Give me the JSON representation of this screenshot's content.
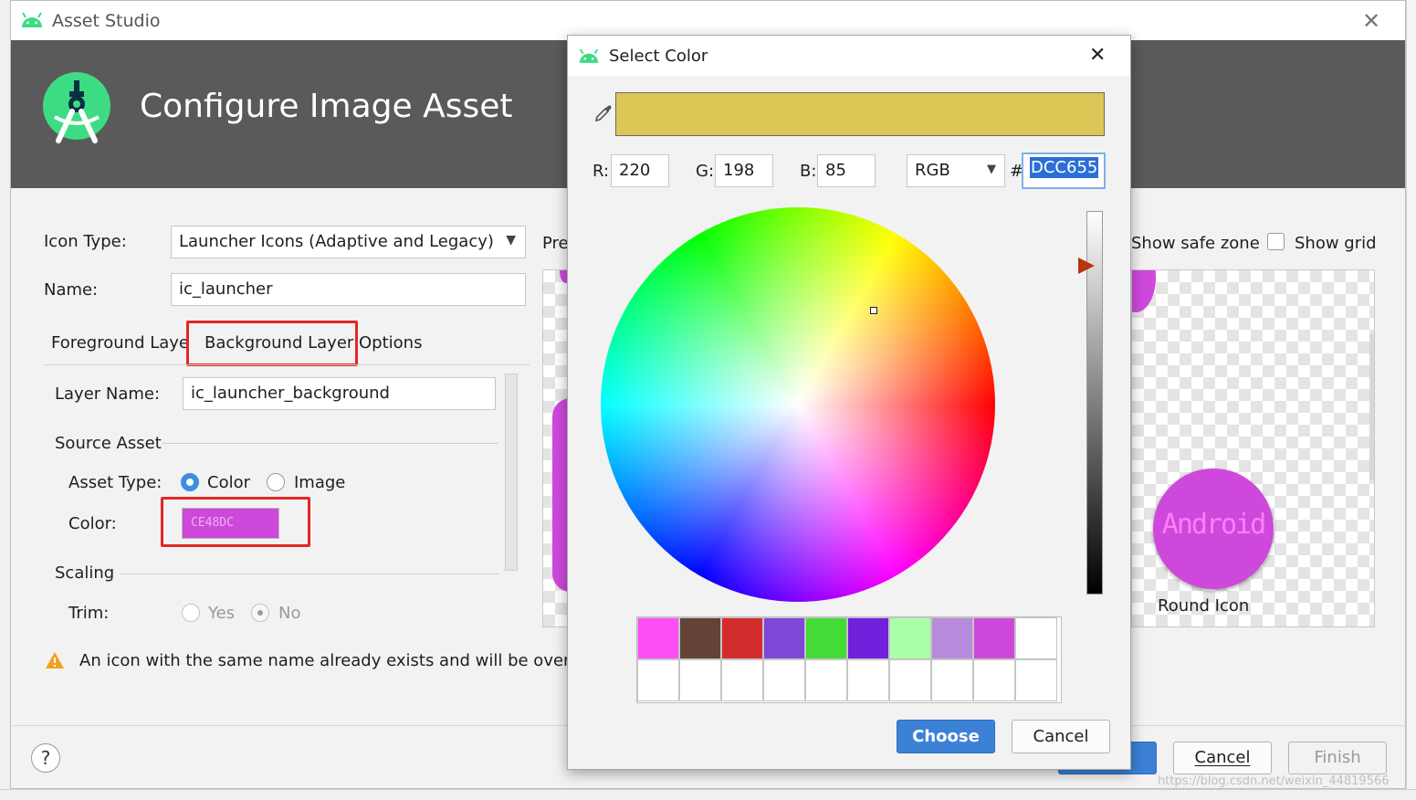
{
  "window": {
    "title": "Asset Studio",
    "close_icon": "close-icon"
  },
  "header": {
    "title": "Configure Image Asset"
  },
  "form": {
    "icon_type_label": "Icon Type:",
    "icon_type_value": "Launcher Icons (Adaptive and Legacy)",
    "name_label": "Name:",
    "name_value": "ic_launcher",
    "tabs": [
      {
        "label": "Foreground Layer",
        "selected": false
      },
      {
        "label": "Background Layer",
        "selected": true
      },
      {
        "label": "Options",
        "selected": false
      }
    ],
    "layer_name_label": "Layer Name:",
    "layer_name_value": "ic_launcher_background",
    "source_asset_label": "Source Asset",
    "asset_type_label": "Asset Type:",
    "asset_type_options": [
      "Color",
      "Image"
    ],
    "asset_type_selected": "Color",
    "color_label": "Color:",
    "color_value": "CE48DC",
    "color_hex": "#ce48dc",
    "scaling_label": "Scaling",
    "trim_label": "Trim:",
    "trim_options": [
      "Yes",
      "No"
    ],
    "trim_selected": "No"
  },
  "warning": {
    "text": "An icon with the same name already exists and will be overwrit"
  },
  "preview": {
    "label": "Pre",
    "show_safe_zone_label": "Show safe zone",
    "show_grid_label": "Show grid",
    "round_icon_label": "Round Icon",
    "round_icon_text": "Android"
  },
  "footer": {
    "help_label": "?",
    "cancel_label": "Cancel",
    "finish_label": "Finish"
  },
  "color_dialog": {
    "title": "Select Color",
    "preview_color": "#dcc655",
    "r_label": "R:",
    "r_value": "220",
    "g_label": "G:",
    "g_value": "198",
    "b_label": "B:",
    "b_value": "85",
    "mode": "RGB",
    "hash_label": "#",
    "hex_value": "DCC655",
    "swatches": [
      "#ff4ef8",
      "#624335",
      "#d42c2c",
      "#7d48d6",
      "#44db36",
      "#7121db",
      "#abffa7",
      "#b88adb",
      "#ce48dc",
      "#ffffff"
    ],
    "choose_label": "Choose",
    "cancel_label": "Cancel"
  },
  "watermark": "https://blog.csdn.net/weixin_44819566"
}
